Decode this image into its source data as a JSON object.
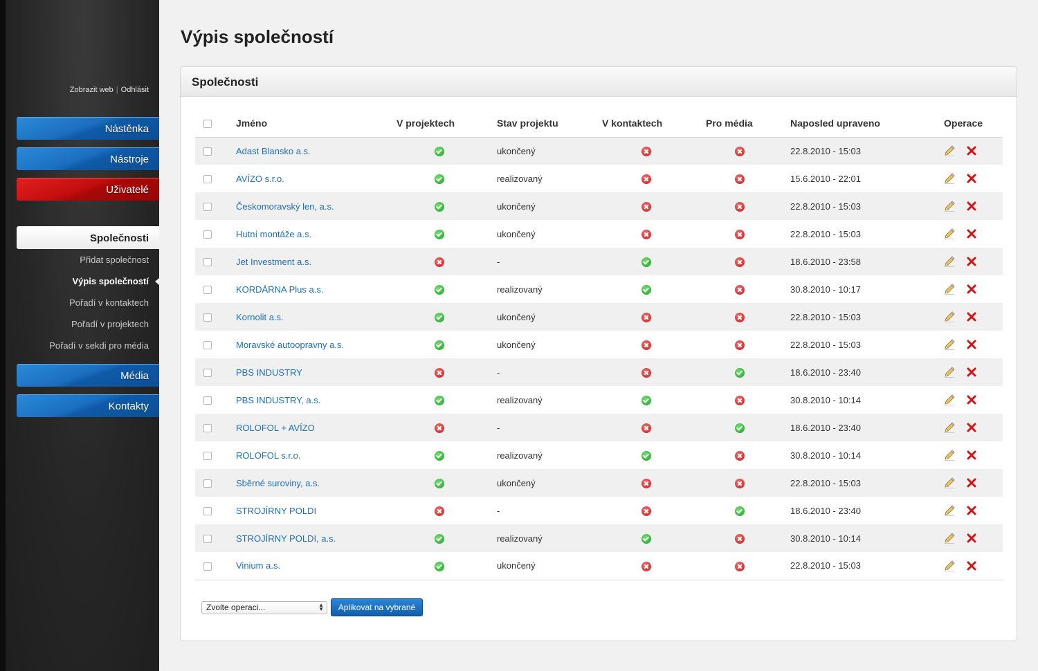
{
  "page": {
    "title": "Výpis společností"
  },
  "toplinks": {
    "view_web": "Zobrazit web",
    "separator": "|",
    "logout": "Odhlásit"
  },
  "nav": {
    "dashboard": "Nástěnka",
    "tools": "Nástroje",
    "users": "Uživatelé",
    "companies": "Společnosti",
    "sub": {
      "add": "Přidat společnost",
      "list": "Výpis společností",
      "order_contacts": "Pořadí v kontaktech",
      "order_projects": "Pořadí v projektech",
      "order_media": "Pořadí v sekdi pro média"
    },
    "media": "Média",
    "contacts": "Kontakty"
  },
  "panel": {
    "title": "Společnosti"
  },
  "table": {
    "headers": {
      "name": "Jméno",
      "in_projects": "V projektech",
      "project_state": "Stav projektu",
      "in_contacts": "V kontaktech",
      "for_media": "Pro média",
      "last_modified": "Naposled upraveno",
      "operations": "Operace"
    },
    "rows": [
      {
        "name": "Adast Blansko a.s.",
        "in_projects": true,
        "state": "ukončený",
        "in_contacts": false,
        "for_media": false,
        "modified": "22.8.2010 - 15:03"
      },
      {
        "name": "AVÍZO s.r.o.",
        "in_projects": true,
        "state": "realizovaný",
        "in_contacts": false,
        "for_media": false,
        "modified": "15.6.2010 - 22:01"
      },
      {
        "name": "Českomoravský len, a.s.",
        "in_projects": true,
        "state": "ukončený",
        "in_contacts": false,
        "for_media": false,
        "modified": "22.8.2010 - 15:03"
      },
      {
        "name": "Hutní montáže a.s.",
        "in_projects": true,
        "state": "ukončený",
        "in_contacts": false,
        "for_media": false,
        "modified": "22.8.2010 - 15:03"
      },
      {
        "name": "Jet Investment a.s.",
        "in_projects": false,
        "state": "-",
        "in_contacts": true,
        "for_media": false,
        "modified": "18.6.2010 - 23:58"
      },
      {
        "name": "KORDÁRNA Plus a.s.",
        "in_projects": true,
        "state": "realizovaný",
        "in_contacts": true,
        "for_media": false,
        "modified": "30.8.2010 - 10:17"
      },
      {
        "name": "Kornolit a.s.",
        "in_projects": true,
        "state": "ukončený",
        "in_contacts": false,
        "for_media": false,
        "modified": "22.8.2010 - 15:03"
      },
      {
        "name": "Moravské autoopravny a.s.",
        "in_projects": true,
        "state": "ukončený",
        "in_contacts": false,
        "for_media": false,
        "modified": "22.8.2010 - 15:03"
      },
      {
        "name": "PBS INDUSTRY",
        "in_projects": false,
        "state": "-",
        "in_contacts": false,
        "for_media": true,
        "modified": "18.6.2010 - 23:40"
      },
      {
        "name": "PBS INDUSTRY, a.s.",
        "in_projects": true,
        "state": "realizovaný",
        "in_contacts": true,
        "for_media": false,
        "modified": "30.8.2010 - 10:14"
      },
      {
        "name": "ROLOFOL + AVÍZO",
        "in_projects": false,
        "state": "-",
        "in_contacts": false,
        "for_media": true,
        "modified": "18.6.2010 - 23:40"
      },
      {
        "name": "ROLOFOL s.r.o.",
        "in_projects": true,
        "state": "realizovaný",
        "in_contacts": true,
        "for_media": false,
        "modified": "30.8.2010 - 10:14"
      },
      {
        "name": "Sběrné suroviny, a.s.",
        "in_projects": true,
        "state": "ukončený",
        "in_contacts": false,
        "for_media": false,
        "modified": "22.8.2010 - 15:03"
      },
      {
        "name": "STROJÍRNY POLDI",
        "in_projects": false,
        "state": "-",
        "in_contacts": false,
        "for_media": true,
        "modified": "18.6.2010 - 23:40"
      },
      {
        "name": "STROJÍRNY POLDI, a.s.",
        "in_projects": true,
        "state": "realizovaný",
        "in_contacts": true,
        "for_media": false,
        "modified": "30.8.2010 - 10:14"
      },
      {
        "name": "Vinium a.s.",
        "in_projects": true,
        "state": "ukončený",
        "in_contacts": false,
        "for_media": false,
        "modified": "22.8.2010 - 15:03"
      }
    ]
  },
  "bulk": {
    "select_value": "Zvolte operaci...",
    "apply_label": "Aplikovat na vybrané"
  },
  "icons": {
    "yes": "check-circle-icon",
    "no": "cross-circle-icon",
    "edit": "pencil-icon",
    "delete": "red-x-icon"
  },
  "colors": {
    "link": "#1f6fb5",
    "nav_blue": "#1c6fc0",
    "nav_red": "#c40e0e",
    "ok": "#1e9e26",
    "no": "#c41a1a"
  }
}
